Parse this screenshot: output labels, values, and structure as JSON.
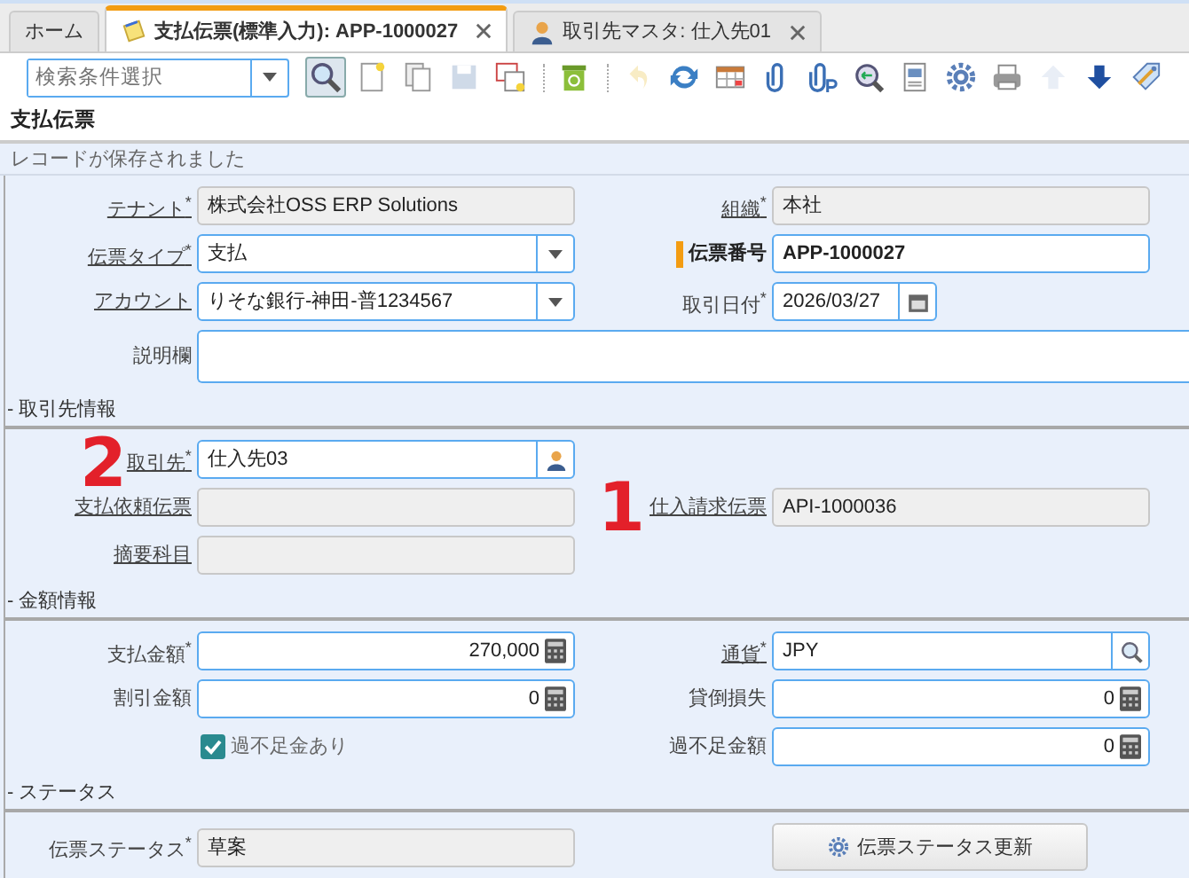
{
  "tabs": [
    {
      "label": "ホーム",
      "kind": "plain",
      "selected": false,
      "closable": false
    },
    {
      "label": "支払伝票(標準入力): APP-1000027",
      "kind": "note",
      "selected": true,
      "closable": true
    },
    {
      "label": "取引先マスタ: 仕入先01",
      "kind": "person",
      "selected": false,
      "closable": true
    }
  ],
  "toolbar": {
    "search": {
      "placeholder": "検索条件選択"
    },
    "buttons": [
      {
        "kind": "find",
        "selected": true,
        "disabled": false
      },
      {
        "kind": "new",
        "selected": false,
        "disabled": false
      },
      {
        "kind": "copy",
        "selected": false,
        "disabled": false
      },
      {
        "kind": "save",
        "selected": false,
        "disabled": true
      },
      {
        "kind": "window",
        "selected": false,
        "disabled": false
      },
      {
        "kind": "separator"
      },
      {
        "kind": "delete",
        "selected": false,
        "disabled": false
      },
      {
        "kind": "separator"
      },
      {
        "kind": "undo",
        "selected": false,
        "disabled": true
      },
      {
        "kind": "refresh",
        "selected": false,
        "disabled": false
      },
      {
        "kind": "grid",
        "selected": false,
        "disabled": false
      },
      {
        "kind": "attach",
        "selected": false,
        "disabled": false
      },
      {
        "kind": "attach-p",
        "selected": false,
        "disabled": false
      },
      {
        "kind": "zoom",
        "selected": false,
        "disabled": false
      },
      {
        "kind": "report",
        "selected": false,
        "disabled": false
      },
      {
        "kind": "gear",
        "selected": false,
        "disabled": false
      },
      {
        "kind": "print",
        "selected": false,
        "disabled": false
      },
      {
        "kind": "up",
        "selected": false,
        "disabled": true
      },
      {
        "kind": "down",
        "selected": false,
        "disabled": false
      },
      {
        "kind": "tag",
        "selected": false,
        "disabled": false
      }
    ]
  },
  "title": "支払伝票",
  "message": "レコードが保存されました",
  "rows": [
    {
      "kind": "fields",
      "left": {
        "label": "テナント$^{*}$",
        "linked": true,
        "kind": "readonly",
        "value": "株式会社OSS ERP Solutions"
      },
      "right": {
        "label": "組織$^{*}$",
        "linked": true,
        "kind": "readonly",
        "value": "本社"
      }
    },
    {
      "kind": "fields",
      "left": {
        "label": "伝票タイプ$^{*}$",
        "linked": true,
        "kind": "select",
        "value": "支払"
      },
      "right": {
        "label": "伝票番号",
        "linked": false,
        "emphasis": true,
        "kind": "text",
        "value": "APP-1000027"
      }
    },
    {
      "kind": "fields",
      "left": {
        "label": "アカウント",
        "linked": true,
        "kind": "select",
        "value": "りそな銀行-神田-普1234567"
      },
      "right": {
        "label": "取引日付$^{*}$",
        "linked": false,
        "kind": "date",
        "value": "2026/03/27"
      }
    },
    {
      "kind": "wide",
      "field": {
        "label": "説明欄",
        "linked": false,
        "kind": "textarea"
      }
    },
    {
      "kind": "section",
      "title": "- 取引先情報"
    },
    {
      "kind": "fields",
      "left": {
        "label": "取引先$^{*}$",
        "linked": true,
        "kind": "lookup",
        "value": "仕入先03"
      }
    },
    {
      "kind": "fields",
      "left": {
        "label": "支払依頼伝票",
        "linked": true,
        "kind": "readonly"
      },
      "right": {
        "label": "仕入請求伝票",
        "linked": true,
        "kind": "readonly",
        "value": "API-1000036"
      }
    },
    {
      "kind": "fields",
      "left": {
        "label": "摘要科目",
        "linked": true,
        "kind": "readonly"
      }
    },
    {
      "kind": "section",
      "title": "- 金額情報"
    },
    {
      "kind": "fields",
      "left": {
        "label": "支払金額$^{*}$",
        "linked": false,
        "kind": "number",
        "value": "270,000"
      },
      "right": {
        "label": "通貨$^{*}$",
        "linked": true,
        "kind": "search",
        "value": "JPY"
      }
    },
    {
      "kind": "fields",
      "left": {
        "label": "割引金額",
        "linked": false,
        "kind": "number",
        "value": "0"
      },
      "right": {
        "label": "貸倒損失",
        "linked": false,
        "kind": "number",
        "value": "0"
      }
    },
    {
      "kind": "fields",
      "left": {
        "label": "過不足金あり",
        "kind": "checkbox",
        "checked": true
      },
      "right": {
        "label": "過不足金額",
        "linked": false,
        "kind": "number",
        "value": "0"
      }
    },
    {
      "kind": "section",
      "title": "- ステータス"
    },
    {
      "kind": "fields",
      "left": {
        "label": "伝票ステータス$^{*}$",
        "linked": false,
        "kind": "readonly",
        "value": "草案"
      },
      "right": {
        "label": "伝票ステータス更新",
        "kind": "button"
      }
    }
  ],
  "annotations": [
    {
      "text": "2"
    },
    {
      "text": "1"
    }
  ]
}
